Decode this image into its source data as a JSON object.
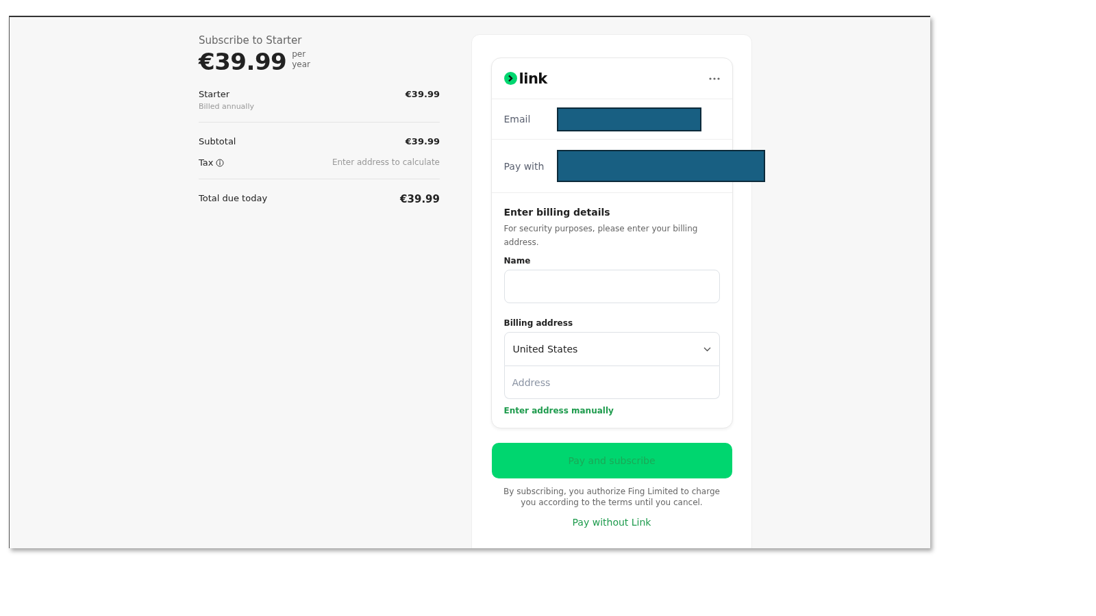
{
  "summary": {
    "title": "Subscribe to Starter",
    "price": "€39.99",
    "period": [
      "per",
      "year"
    ],
    "item": {
      "name": "Starter",
      "note": "Billed annually",
      "amount": "€39.99"
    },
    "subtotal": {
      "label": "Subtotal",
      "amount": "€39.99"
    },
    "tax": {
      "label": "Tax",
      "value": "Enter address to calculate"
    },
    "total": {
      "label": "Total due today",
      "amount": "€39.99"
    }
  },
  "link": {
    "logo": "link",
    "rows": [
      {
        "label": "Email",
        "redacted": true
      },
      {
        "label": "Pay with",
        "redacted": true
      }
    ]
  },
  "billing": {
    "title": "Enter billing details",
    "description": "For security purposes, please enter your billing address.",
    "name_label": "Name",
    "address_label": "Billing address",
    "country": "United States",
    "address_placeholder": "Address",
    "manual_link": "Enter address manually"
  },
  "pay_button": {
    "label": "Pay and subscribe",
    "disabled": true
  },
  "legal": "By subscribing, you authorize Fing Limited to charge you according to the terms until you cancel.",
  "pay_without": "Pay without Link"
}
